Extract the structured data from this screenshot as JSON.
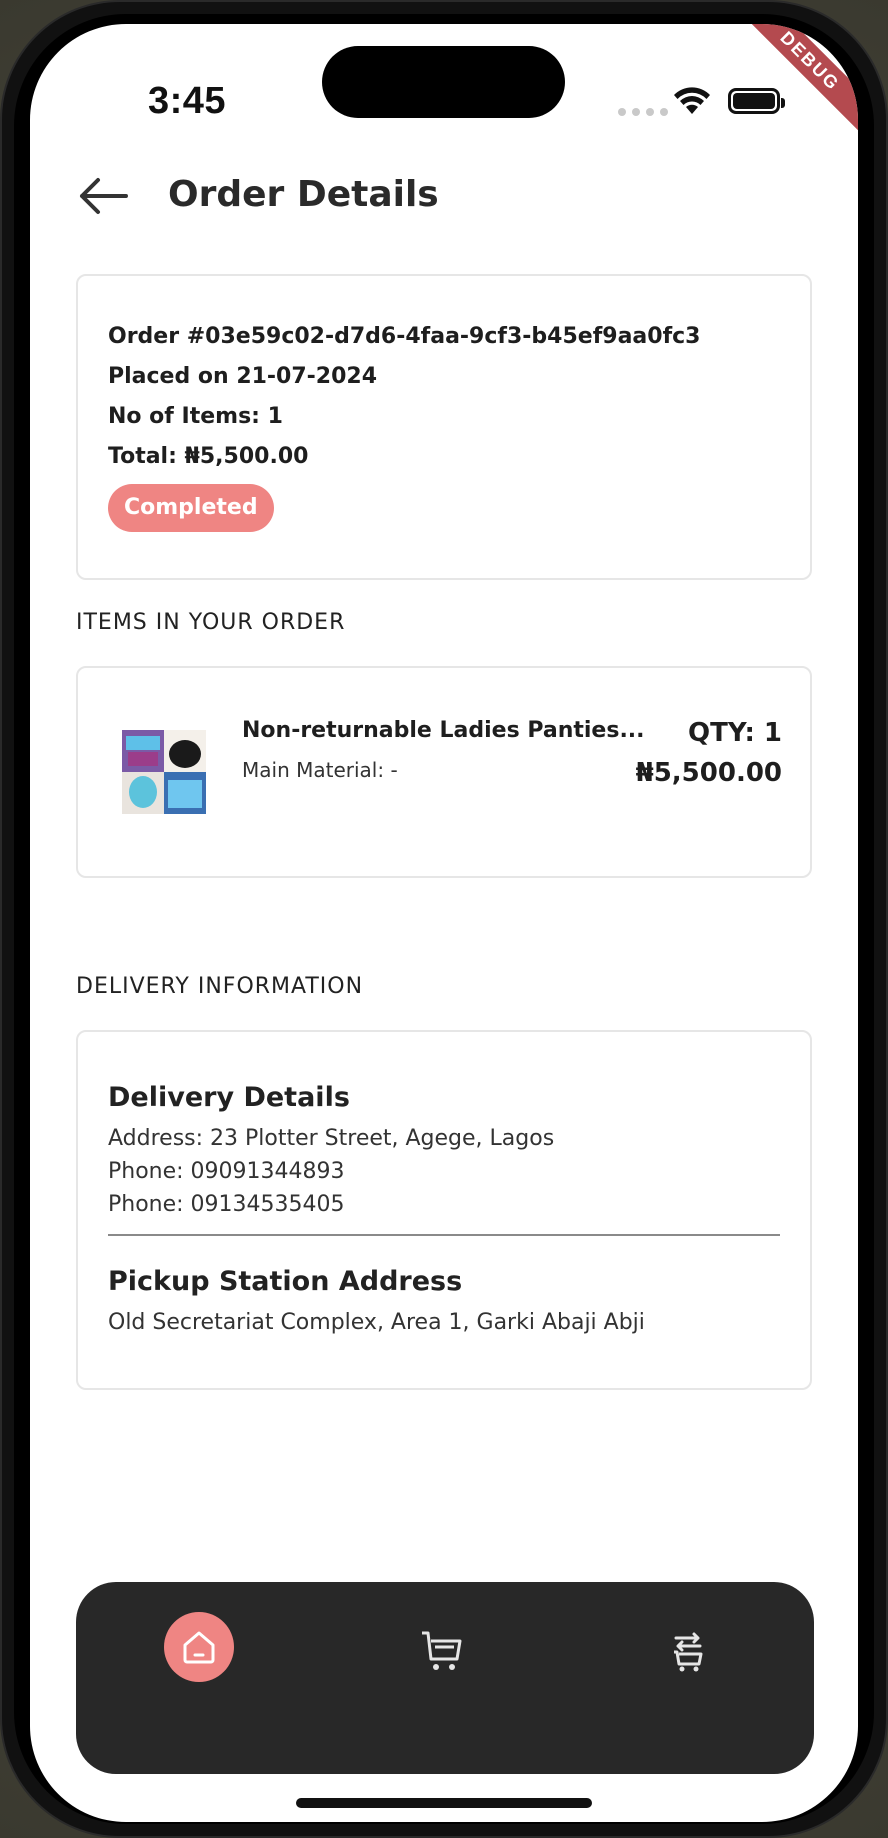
{
  "status_bar": {
    "time": "3:45",
    "debug_label": "DEBUG"
  },
  "header": {
    "title": "Order Details"
  },
  "order": {
    "order_number": "Order #03e59c02-d7d6-4faa-9cf3-b45ef9aa0fc3",
    "placed_on": "Placed on 21-07-2024",
    "items_count": "No of Items: 1",
    "total": "Total: ₦5,500.00",
    "status": "Completed"
  },
  "items_section": {
    "label": "ITEMS IN YOUR ORDER",
    "items": [
      {
        "name": "Non-returnable Ladies Panties...",
        "material": "Main Material: -",
        "qty": "QTY: 1",
        "price": "₦5,500.00"
      }
    ]
  },
  "delivery_section": {
    "label": "DELIVERY INFORMATION",
    "details_title": "Delivery Details",
    "address": "Address: 23 Plotter Street, Agege, Lagos",
    "phone1": "Phone: 09091344893",
    "phone2": "Phone: 09134535405",
    "pickup_title": "Pickup Station Address",
    "pickup_address": "Old Secretariat Complex, Area 1, Garki Abaji Abji"
  },
  "bottom_nav": {
    "items": [
      {
        "icon": "home-icon",
        "active": true
      },
      {
        "icon": "cart-icon",
        "active": false
      },
      {
        "icon": "orders-icon",
        "active": false
      }
    ],
    "accent_color": "#ef8583",
    "background_color": "#282828"
  },
  "colors": {
    "badge": "#ef8583",
    "debug_ribbon": "#b44a4f"
  }
}
